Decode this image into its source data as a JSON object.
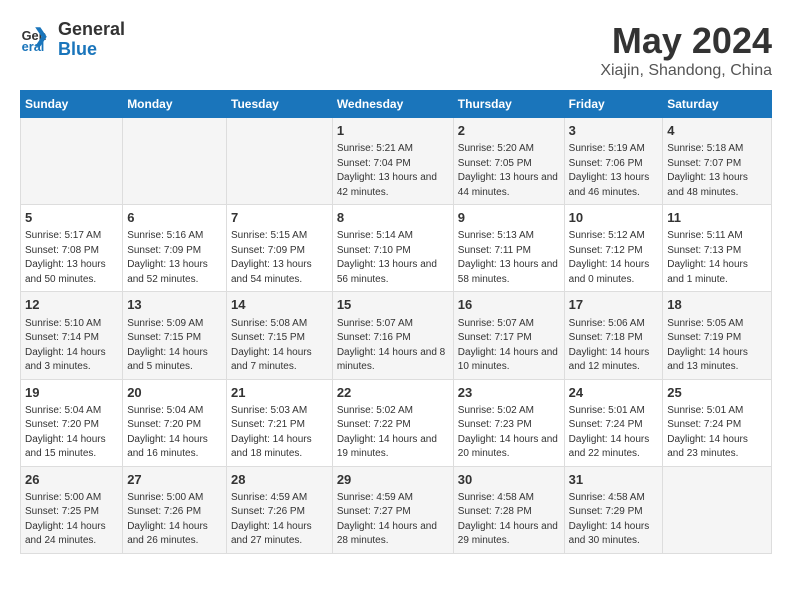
{
  "header": {
    "logo_general": "General",
    "logo_blue": "Blue",
    "main_title": "May 2024",
    "subtitle": "Xiajin, Shandong, China"
  },
  "weekdays": [
    "Sunday",
    "Monday",
    "Tuesday",
    "Wednesday",
    "Thursday",
    "Friday",
    "Saturday"
  ],
  "weeks": [
    [
      {
        "day": "",
        "info": ""
      },
      {
        "day": "",
        "info": ""
      },
      {
        "day": "",
        "info": ""
      },
      {
        "day": "1",
        "info": "Sunrise: 5:21 AM\nSunset: 7:04 PM\nDaylight: 13 hours\nand 42 minutes."
      },
      {
        "day": "2",
        "info": "Sunrise: 5:20 AM\nSunset: 7:05 PM\nDaylight: 13 hours\nand 44 minutes."
      },
      {
        "day": "3",
        "info": "Sunrise: 5:19 AM\nSunset: 7:06 PM\nDaylight: 13 hours\nand 46 minutes."
      },
      {
        "day": "4",
        "info": "Sunrise: 5:18 AM\nSunset: 7:07 PM\nDaylight: 13 hours\nand 48 minutes."
      }
    ],
    [
      {
        "day": "5",
        "info": "Sunrise: 5:17 AM\nSunset: 7:08 PM\nDaylight: 13 hours\nand 50 minutes."
      },
      {
        "day": "6",
        "info": "Sunrise: 5:16 AM\nSunset: 7:09 PM\nDaylight: 13 hours\nand 52 minutes."
      },
      {
        "day": "7",
        "info": "Sunrise: 5:15 AM\nSunset: 7:09 PM\nDaylight: 13 hours\nand 54 minutes."
      },
      {
        "day": "8",
        "info": "Sunrise: 5:14 AM\nSunset: 7:10 PM\nDaylight: 13 hours\nand 56 minutes."
      },
      {
        "day": "9",
        "info": "Sunrise: 5:13 AM\nSunset: 7:11 PM\nDaylight: 13 hours\nand 58 minutes."
      },
      {
        "day": "10",
        "info": "Sunrise: 5:12 AM\nSunset: 7:12 PM\nDaylight: 14 hours\nand 0 minutes."
      },
      {
        "day": "11",
        "info": "Sunrise: 5:11 AM\nSunset: 7:13 PM\nDaylight: 14 hours\nand 1 minute."
      }
    ],
    [
      {
        "day": "12",
        "info": "Sunrise: 5:10 AM\nSunset: 7:14 PM\nDaylight: 14 hours\nand 3 minutes."
      },
      {
        "day": "13",
        "info": "Sunrise: 5:09 AM\nSunset: 7:15 PM\nDaylight: 14 hours\nand 5 minutes."
      },
      {
        "day": "14",
        "info": "Sunrise: 5:08 AM\nSunset: 7:15 PM\nDaylight: 14 hours\nand 7 minutes."
      },
      {
        "day": "15",
        "info": "Sunrise: 5:07 AM\nSunset: 7:16 PM\nDaylight: 14 hours\nand 8 minutes."
      },
      {
        "day": "16",
        "info": "Sunrise: 5:07 AM\nSunset: 7:17 PM\nDaylight: 14 hours\nand 10 minutes."
      },
      {
        "day": "17",
        "info": "Sunrise: 5:06 AM\nSunset: 7:18 PM\nDaylight: 14 hours\nand 12 minutes."
      },
      {
        "day": "18",
        "info": "Sunrise: 5:05 AM\nSunset: 7:19 PM\nDaylight: 14 hours\nand 13 minutes."
      }
    ],
    [
      {
        "day": "19",
        "info": "Sunrise: 5:04 AM\nSunset: 7:20 PM\nDaylight: 14 hours\nand 15 minutes."
      },
      {
        "day": "20",
        "info": "Sunrise: 5:04 AM\nSunset: 7:20 PM\nDaylight: 14 hours\nand 16 minutes."
      },
      {
        "day": "21",
        "info": "Sunrise: 5:03 AM\nSunset: 7:21 PM\nDaylight: 14 hours\nand 18 minutes."
      },
      {
        "day": "22",
        "info": "Sunrise: 5:02 AM\nSunset: 7:22 PM\nDaylight: 14 hours\nand 19 minutes."
      },
      {
        "day": "23",
        "info": "Sunrise: 5:02 AM\nSunset: 7:23 PM\nDaylight: 14 hours\nand 20 minutes."
      },
      {
        "day": "24",
        "info": "Sunrise: 5:01 AM\nSunset: 7:24 PM\nDaylight: 14 hours\nand 22 minutes."
      },
      {
        "day": "25",
        "info": "Sunrise: 5:01 AM\nSunset: 7:24 PM\nDaylight: 14 hours\nand 23 minutes."
      }
    ],
    [
      {
        "day": "26",
        "info": "Sunrise: 5:00 AM\nSunset: 7:25 PM\nDaylight: 14 hours\nand 24 minutes."
      },
      {
        "day": "27",
        "info": "Sunrise: 5:00 AM\nSunset: 7:26 PM\nDaylight: 14 hours\nand 26 minutes."
      },
      {
        "day": "28",
        "info": "Sunrise: 4:59 AM\nSunset: 7:26 PM\nDaylight: 14 hours\nand 27 minutes."
      },
      {
        "day": "29",
        "info": "Sunrise: 4:59 AM\nSunset: 7:27 PM\nDaylight: 14 hours\nand 28 minutes."
      },
      {
        "day": "30",
        "info": "Sunrise: 4:58 AM\nSunset: 7:28 PM\nDaylight: 14 hours\nand 29 minutes."
      },
      {
        "day": "31",
        "info": "Sunrise: 4:58 AM\nSunset: 7:29 PM\nDaylight: 14 hours\nand 30 minutes."
      },
      {
        "day": "",
        "info": ""
      }
    ]
  ]
}
